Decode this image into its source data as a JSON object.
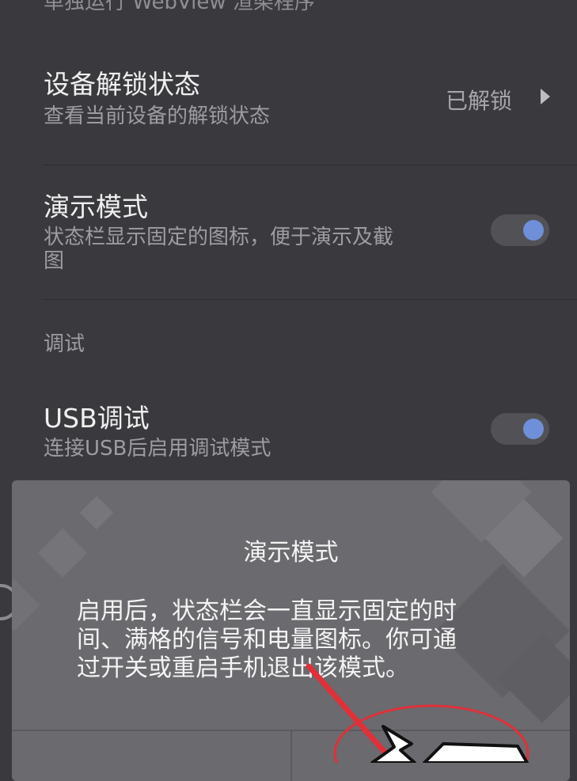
{
  "top_cut_text": "单独运行 WebView 渲染程序",
  "settings": {
    "unlock": {
      "title": "设备解锁状态",
      "subtitle": "查看当前设备的解锁状态",
      "value": "已解锁"
    },
    "demo": {
      "title": "演示模式",
      "subtitle_line1": "状态栏显示固定的图标，便于演示及截",
      "subtitle_line2": "图",
      "enabled": true
    },
    "section_debug": "调试",
    "usb": {
      "title": "USB调试",
      "subtitle": "连接USB后启用调试模式",
      "enabled": true
    }
  },
  "dialog": {
    "title": "演示模式",
    "message_line1": "启用后，状态栏会一直显示固定的时",
    "message_line2": "间、满格的信号和电量图标。你可通",
    "message_line3": "过开关或重启手机退出该模式。"
  },
  "colors": {
    "background": "#3a393d",
    "dialog": "#6b6a6e",
    "toggle_knob": "#6f8fd9",
    "annotation": "#e0303a"
  }
}
